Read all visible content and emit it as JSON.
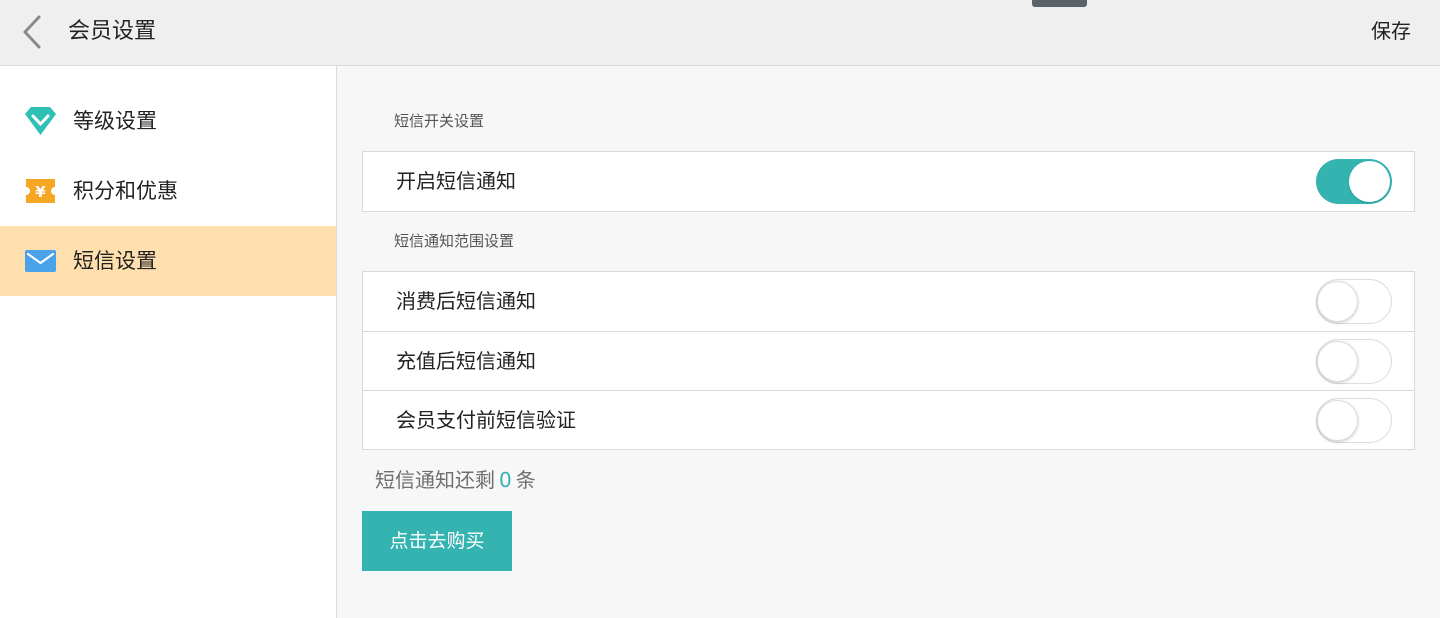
{
  "header": {
    "title": "会员设置",
    "save_label": "保存"
  },
  "sidebar": {
    "items": [
      {
        "label": "等级设置",
        "icon": "diamond-icon",
        "active": false
      },
      {
        "label": "积分和优惠",
        "icon": "coupon-icon",
        "active": false
      },
      {
        "label": "短信设置",
        "icon": "envelope-icon",
        "active": true
      }
    ]
  },
  "main": {
    "switch_section": {
      "title": "短信开关设置",
      "rows": [
        {
          "label": "开启短信通知",
          "enabled": true
        }
      ]
    },
    "scope_section": {
      "title": "短信通知范围设置",
      "rows": [
        {
          "label": "消费后短信通知",
          "enabled": false
        },
        {
          "label": "充值后短信通知",
          "enabled": false
        },
        {
          "label": "会员支付前短信验证",
          "enabled": false
        }
      ]
    },
    "remaining": {
      "prefix": "短信通知还剩",
      "count": "0",
      "suffix": "条"
    },
    "buy_label": "点击去购买"
  },
  "colors": {
    "accent": "#34b3b1",
    "active_item": "#ffdfae",
    "diamond": "#2ebfb5",
    "coupon": "#f5a623",
    "envelope": "#4aa3e8"
  }
}
